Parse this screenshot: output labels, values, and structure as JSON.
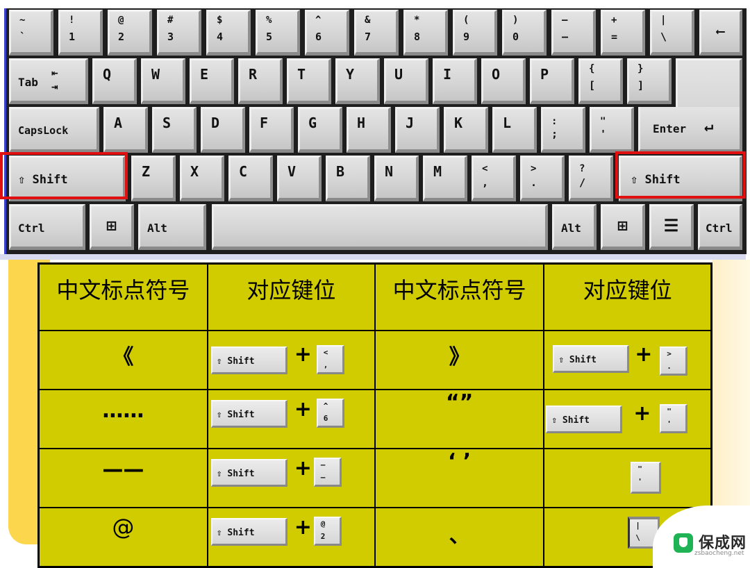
{
  "keyboard": {
    "row1": [
      {
        "top": "~",
        "bot": "`"
      },
      {
        "top": "!",
        "bot": "1"
      },
      {
        "top": "@",
        "bot": "2"
      },
      {
        "top": "#",
        "bot": "3"
      },
      {
        "top": "$",
        "bot": "4"
      },
      {
        "top": "%",
        "bot": "5"
      },
      {
        "top": "^",
        "bot": "6"
      },
      {
        "top": "&",
        "bot": "7"
      },
      {
        "top": "*",
        "bot": "8"
      },
      {
        "top": "(",
        "bot": "9"
      },
      {
        "top": ")",
        "bot": "0"
      },
      {
        "top": "—",
        "bot": "–"
      },
      {
        "top": "+",
        "bot": "="
      },
      {
        "top": "|",
        "bot": "\\"
      },
      {
        "label": "⟵"
      }
    ],
    "row2": {
      "tab": "Tab",
      "tab_arrows": "⇤⇥",
      "letters": [
        "Q",
        "W",
        "E",
        "R",
        "T",
        "Y",
        "U",
        "I",
        "O",
        "P"
      ],
      "brackets": [
        {
          "top": "{",
          "bot": "["
        },
        {
          "top": "}",
          "bot": "]"
        }
      ]
    },
    "row3": {
      "capslock": "CapsLock",
      "letters": [
        "A",
        "S",
        "D",
        "F",
        "G",
        "H",
        "J",
        "K",
        "L"
      ],
      "semicolon": {
        "top": ":",
        "bot": ";"
      },
      "quote": {
        "top": "\"",
        "bot": "'"
      },
      "enter": "Enter",
      "enter_arrow": "↵"
    },
    "row4": {
      "shift_left": "⇧ Shift",
      "letters": [
        "Z",
        "X",
        "C",
        "V",
        "B",
        "N",
        "M"
      ],
      "punct": [
        {
          "top": "<",
          "bot": ","
        },
        {
          "top": ">",
          "bot": "."
        },
        {
          "top": "?",
          "bot": "/"
        }
      ],
      "shift_right": "⇧ Shift"
    },
    "row5": {
      "ctrl_left": "Ctrl",
      "win_left": "⊞",
      "alt_left": "Alt",
      "space": "",
      "alt_right": "Alt",
      "win_right": "⊞",
      "menu": "☰",
      "ctrl_right": "Ctrl"
    }
  },
  "table": {
    "headers": [
      "中文标点符号",
      "对应键位",
      "中文标点符号",
      "对应键位"
    ],
    "rows": [
      {
        "left_symbol": "《",
        "left_keys": {
          "modifier": "⇧ Shift",
          "plus": "+",
          "key_top": "<",
          "key_bot": ","
        },
        "right_symbol": "》",
        "right_keys": {
          "modifier": "⇧ Shift",
          "plus": "+",
          "key_top": ">",
          "key_bot": "."
        }
      },
      {
        "left_symbol": "……",
        "left_keys": {
          "modifier": "⇧ Shift",
          "plus": "+",
          "key_top": "^",
          "key_bot": "6"
        },
        "right_symbol": "“”",
        "right_keys": {
          "modifier": "⇧ Shift",
          "plus": "+",
          "key_top": "\"",
          "key_bot": "'"
        }
      },
      {
        "left_symbol": "——",
        "left_keys": {
          "modifier": "⇧ Shift",
          "plus": "+",
          "key_top": "—",
          "key_bot": "–"
        },
        "right_symbol": "‘ ’",
        "right_keys": {
          "key_top": "\"",
          "key_bot": "'"
        }
      },
      {
        "left_symbol": "@",
        "left_keys": {
          "modifier": "⇧ Shift",
          "plus": "+",
          "key_top": "@",
          "key_bot": "2"
        },
        "right_symbol": "、",
        "right_keys": {
          "key_top": "|",
          "key_bot": "\\"
        }
      }
    ]
  },
  "watermark": {
    "name": "保成网",
    "url": "zsbaocheng.net",
    "logo_color": "#1fb356"
  },
  "colors": {
    "table_bg": "#d0cc00",
    "highlight": "#e01010",
    "left_band": "#fcd64c"
  }
}
